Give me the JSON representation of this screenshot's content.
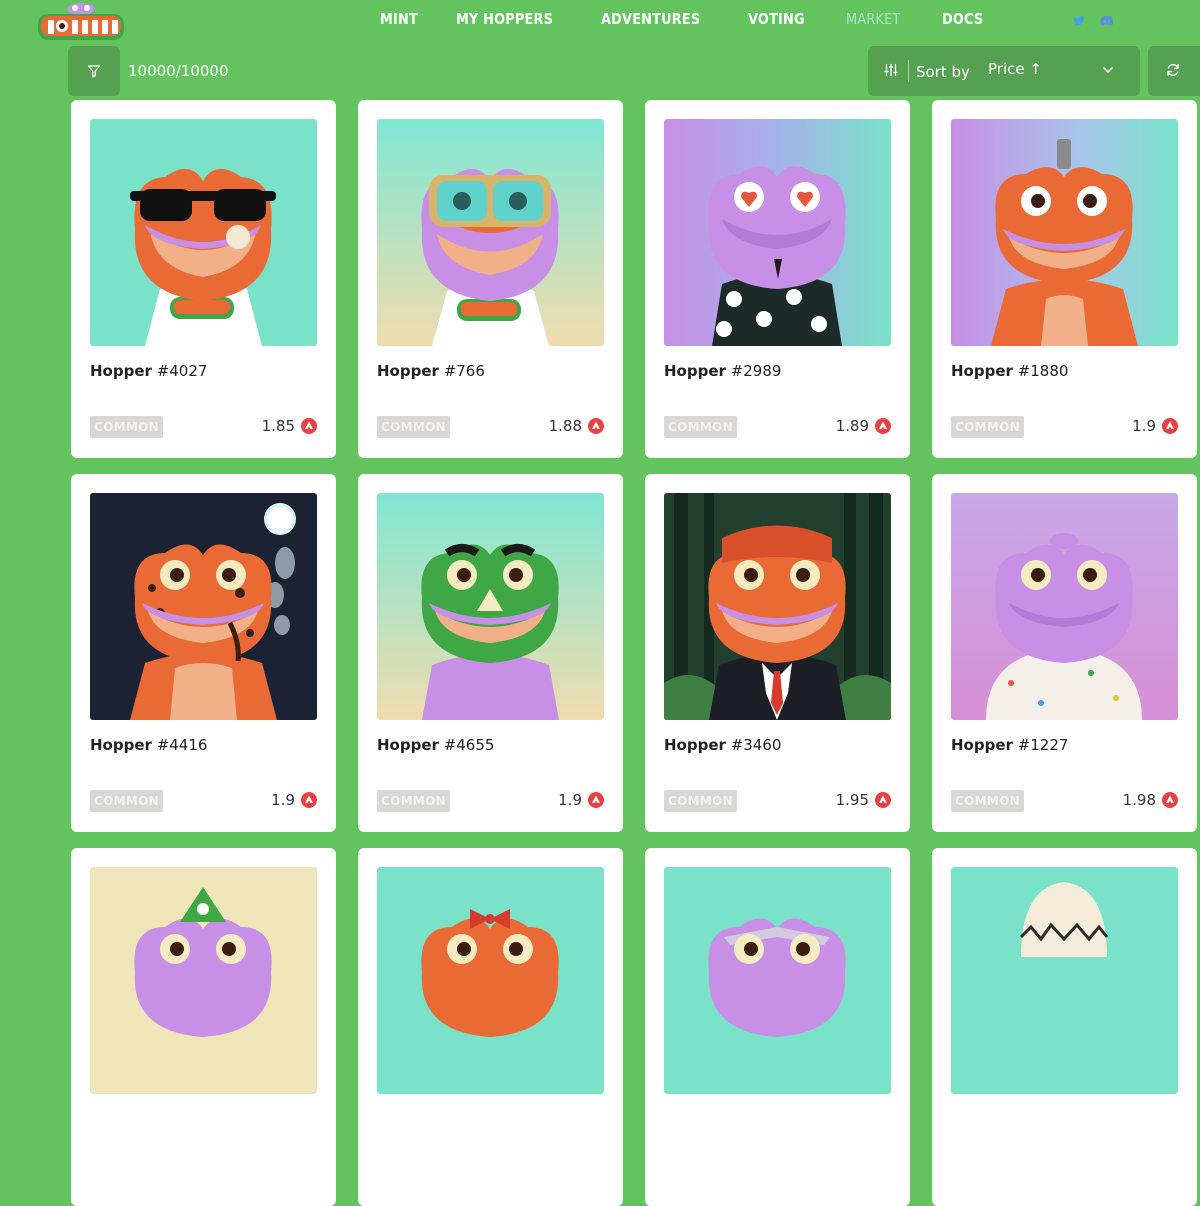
{
  "nav": {
    "items": [
      {
        "label": "MINT",
        "active": false
      },
      {
        "label": "MY HOPPERS",
        "active": false
      },
      {
        "label": "ADVENTURES",
        "active": false
      },
      {
        "label": "VOTING",
        "active": false
      },
      {
        "label": "MARKET",
        "active": true
      },
      {
        "label": "DOCS",
        "active": false
      }
    ],
    "social_icons": [
      "twitter-icon",
      "discord-icon"
    ]
  },
  "toolbar": {
    "count": "10000/10000",
    "filter_icon": "filter-icon",
    "sort_label": "Sort by",
    "sort_value": "Price ↑",
    "sort_icon": "sliders-icon",
    "refresh_icon": "refresh-icon"
  },
  "colors": {
    "background": "#63c35f",
    "toolbar": "#56a052",
    "card": "#ffffff",
    "frog_orange": "#ea6a36",
    "frog_purple": "#c78fe6",
    "frog_green": "#3fa745",
    "avax": "#e84142"
  },
  "cards": [
    {
      "prefix": "Hopper",
      "id": "#4027",
      "rarity": "COMMON",
      "price": "1.85"
    },
    {
      "prefix": "Hopper",
      "id": "#766",
      "rarity": "COMMON",
      "price": "1.88"
    },
    {
      "prefix": "Hopper",
      "id": "#2989",
      "rarity": "COMMON",
      "price": "1.89"
    },
    {
      "prefix": "Hopper",
      "id": "#1880",
      "rarity": "COMMON",
      "price": "1.9"
    },
    {
      "prefix": "Hopper",
      "id": "#4416",
      "rarity": "COMMON",
      "price": "1.9"
    },
    {
      "prefix": "Hopper",
      "id": "#4655",
      "rarity": "COMMON",
      "price": "1.9"
    },
    {
      "prefix": "Hopper",
      "id": "#3460",
      "rarity": "COMMON",
      "price": "1.95"
    },
    {
      "prefix": "Hopper",
      "id": "#1227",
      "rarity": "COMMON",
      "price": "1.98"
    },
    {
      "prefix": "",
      "id": "",
      "rarity": "",
      "price": ""
    },
    {
      "prefix": "",
      "id": "",
      "rarity": "",
      "price": ""
    },
    {
      "prefix": "",
      "id": "",
      "rarity": "",
      "price": ""
    },
    {
      "prefix": "",
      "id": "",
      "rarity": "",
      "price": ""
    }
  ]
}
